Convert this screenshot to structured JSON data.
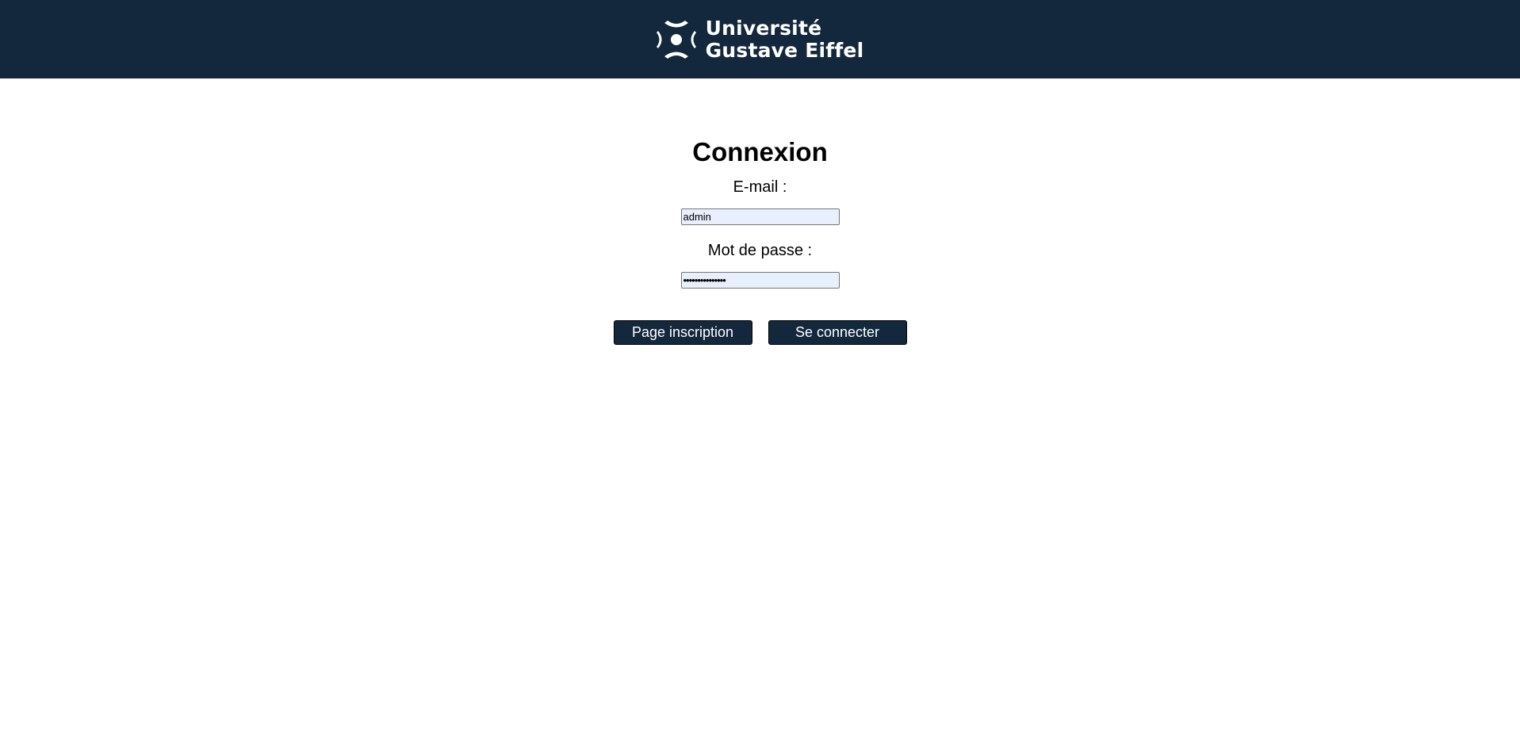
{
  "header": {
    "logo_icon": "universite-gustave-eiffel-logo-icon",
    "logo_line1": "Université",
    "logo_line2": "Gustave Eiffel",
    "background": "#13283c"
  },
  "form": {
    "title": "Connexion",
    "email_label": "E-mail :",
    "email_value": "admin",
    "password_label": "Mot de passe :",
    "password_value": "•••••••••••••••",
    "register_button": "Page inscription",
    "login_button": "Se connecter"
  },
  "colors": {
    "brand": "#13283c",
    "input_autofill": "#e8f0fe"
  }
}
